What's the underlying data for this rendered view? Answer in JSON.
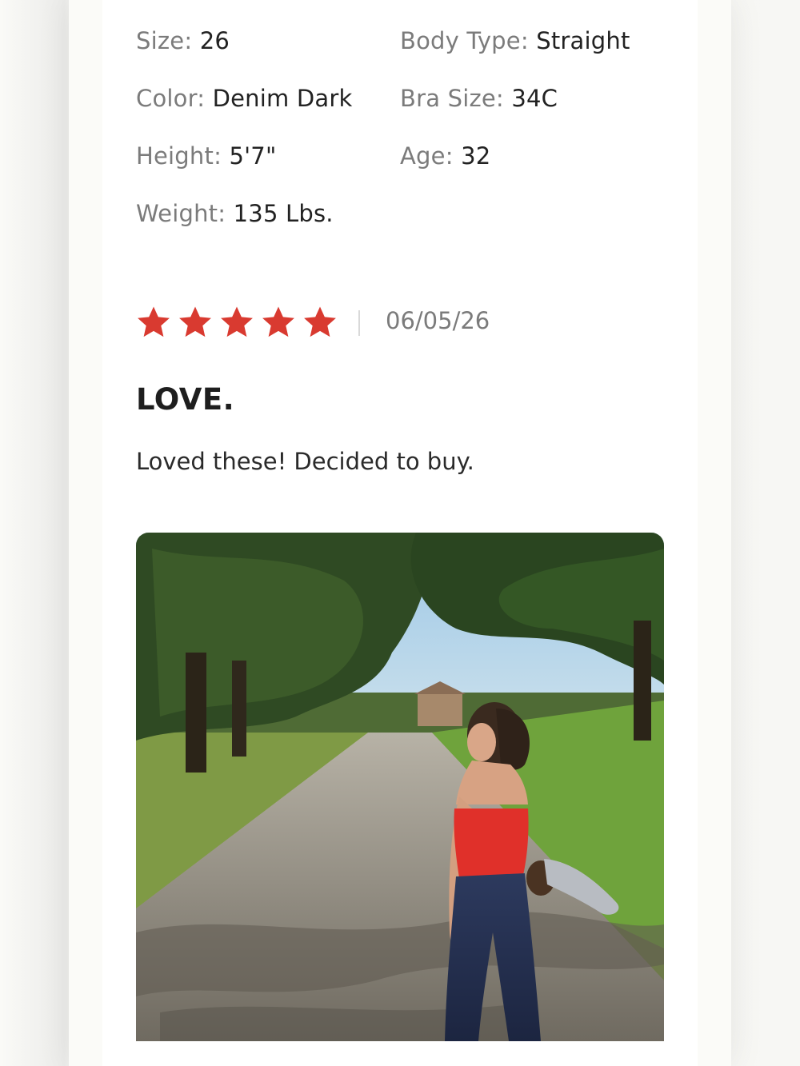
{
  "reviewer_attributes": {
    "size": {
      "label": "Size:",
      "value": "26"
    },
    "body_type": {
      "label": "Body Type:",
      "value": "Straight"
    },
    "color": {
      "label": "Color:",
      "value": "Denim Dark"
    },
    "bra_size": {
      "label": "Bra Size:",
      "value": "34C"
    },
    "height": {
      "label": "Height:",
      "value": "5'7\""
    },
    "age": {
      "label": "Age:",
      "value": "32"
    },
    "weight": {
      "label": "Weight:",
      "value": "135 Lbs."
    }
  },
  "review": {
    "rating": 5,
    "rating_max": 5,
    "date": "06/05/26",
    "title": "LOVE.",
    "body": "Loved these! Decided to buy."
  },
  "colors": {
    "star": "#d93a30",
    "label": "#7b7b7b",
    "value": "#222222"
  },
  "icons": {
    "star": "star-icon"
  }
}
